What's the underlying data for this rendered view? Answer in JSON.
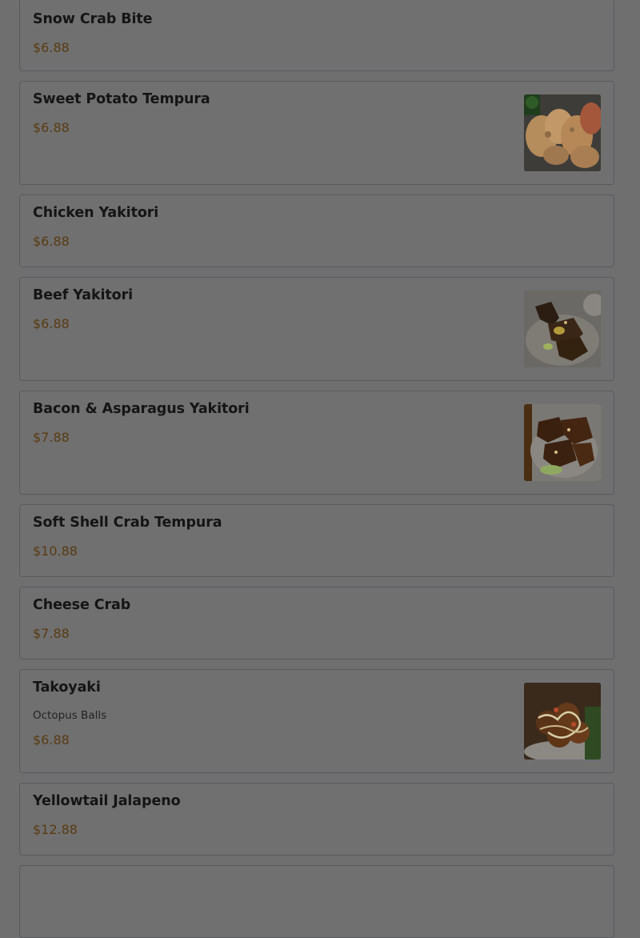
{
  "menu": {
    "items": [
      {
        "name": "Snow Crab Bite",
        "description": "",
        "price": "$6.88",
        "photo": ""
      },
      {
        "name": "Sweet Potato Tempura",
        "description": "",
        "price": "$6.88",
        "photo": "sweet-potato-tempura-photo"
      },
      {
        "name": "Chicken Yakitori",
        "description": "",
        "price": "$6.88",
        "photo": ""
      },
      {
        "name": "Beef Yakitori",
        "description": "",
        "price": "$6.88",
        "photo": "beef-yakitori-photo"
      },
      {
        "name": "Bacon & Asparagus Yakitori",
        "description": "",
        "price": "$7.88",
        "photo": "bacon-asparagus-yakitori-photo"
      },
      {
        "name": "Soft Shell Crab Tempura",
        "description": "",
        "price": "$10.88",
        "photo": ""
      },
      {
        "name": "Cheese Crab",
        "description": "",
        "price": "$7.88",
        "photo": ""
      },
      {
        "name": "Takoyaki",
        "description": "Octopus Balls",
        "price": "$6.88",
        "photo": "takoyaki-photo"
      },
      {
        "name": "Yellowtail Jalapeno",
        "description": "",
        "price": "$12.88",
        "photo": ""
      }
    ]
  },
  "colors": {
    "overlay_background": "#6f6f70",
    "card_border": "#595a5c",
    "item_name": "#151515",
    "item_price": "#5a3b12"
  }
}
